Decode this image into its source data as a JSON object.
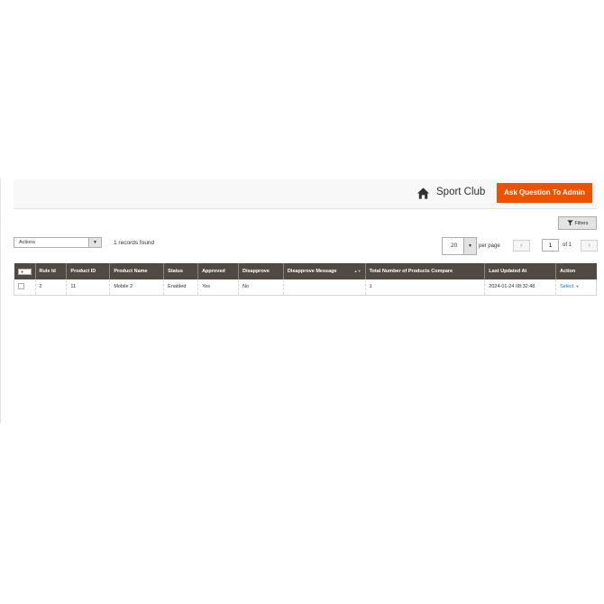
{
  "header": {
    "store_name": "Sport Club",
    "ask_button_label": "Ask Question To Admin"
  },
  "toolbar": {
    "filters_label": "Filters",
    "actions_label": "Actions",
    "records_found": "1 records found",
    "per_page_value": "20",
    "per_page_label": "per page",
    "current_page": "1",
    "page_of": "of 1",
    "prev_symbol": "‹",
    "next_symbol": "›"
  },
  "grid": {
    "columns": [
      "Rule Id",
      "Product ID",
      "Product Name",
      "Status",
      "Approved",
      "Disapprove",
      "Disapprove Message",
      "Total Number of Products Compare",
      "Last Updated At",
      "Action"
    ],
    "rows": [
      {
        "rule_id": "2",
        "product_id": "11",
        "product_name": "Mobile 2",
        "status": "Enabled",
        "approved": "Yes",
        "disapprove": "No",
        "disapprove_message": "",
        "total_compare": "1",
        "last_updated": "2024-01-24 08:32:48",
        "action": "Select"
      }
    ]
  },
  "colors": {
    "accent": "#eb5202",
    "header_bg": "#514943",
    "link": "#007bdb"
  },
  "icons": [
    "home-icon",
    "funnel-icon",
    "chevron-down-icon",
    "chevron-left-icon",
    "chevron-right-icon",
    "sort-icon"
  ]
}
